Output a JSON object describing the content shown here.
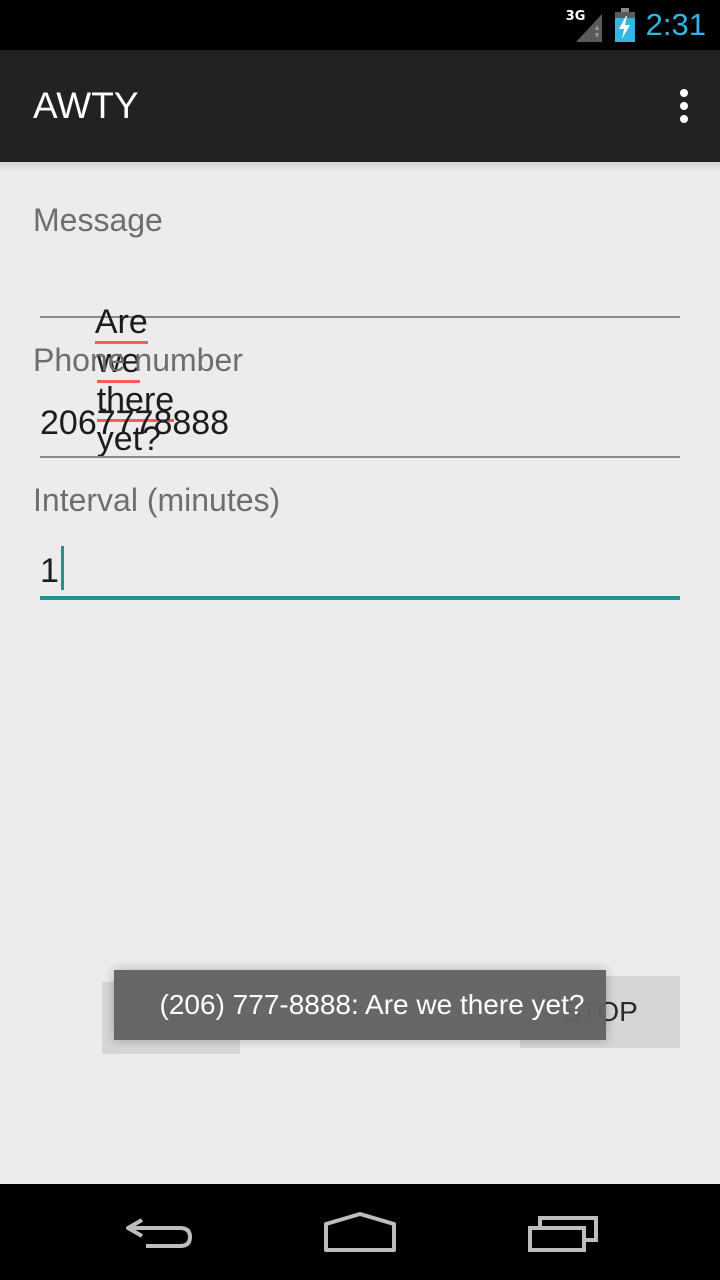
{
  "status_bar": {
    "network_label": "3G",
    "time": "2:31",
    "icons": [
      "signal-icon",
      "battery-charging-icon"
    ]
  },
  "action_bar": {
    "title": "AWTY",
    "overflow_icon": "overflow-menu-icon"
  },
  "form": {
    "message": {
      "label": "Message",
      "value_words": [
        "Are",
        "we",
        "there",
        "yet?"
      ]
    },
    "phone": {
      "label": "Phone number",
      "value": "2067778888"
    },
    "interval": {
      "label": "Interval (minutes)",
      "value": "1"
    }
  },
  "buttons": {
    "stop_label": "STOP"
  },
  "toast": {
    "text": "(206) 777-8888: Are we there yet?"
  },
  "nav_bar": {
    "icons": [
      "back-icon",
      "home-icon",
      "recents-icon"
    ]
  },
  "colors": {
    "accent": "#1e948c",
    "clock": "#33b5e5",
    "spell_error": "#ff5a5a"
  }
}
